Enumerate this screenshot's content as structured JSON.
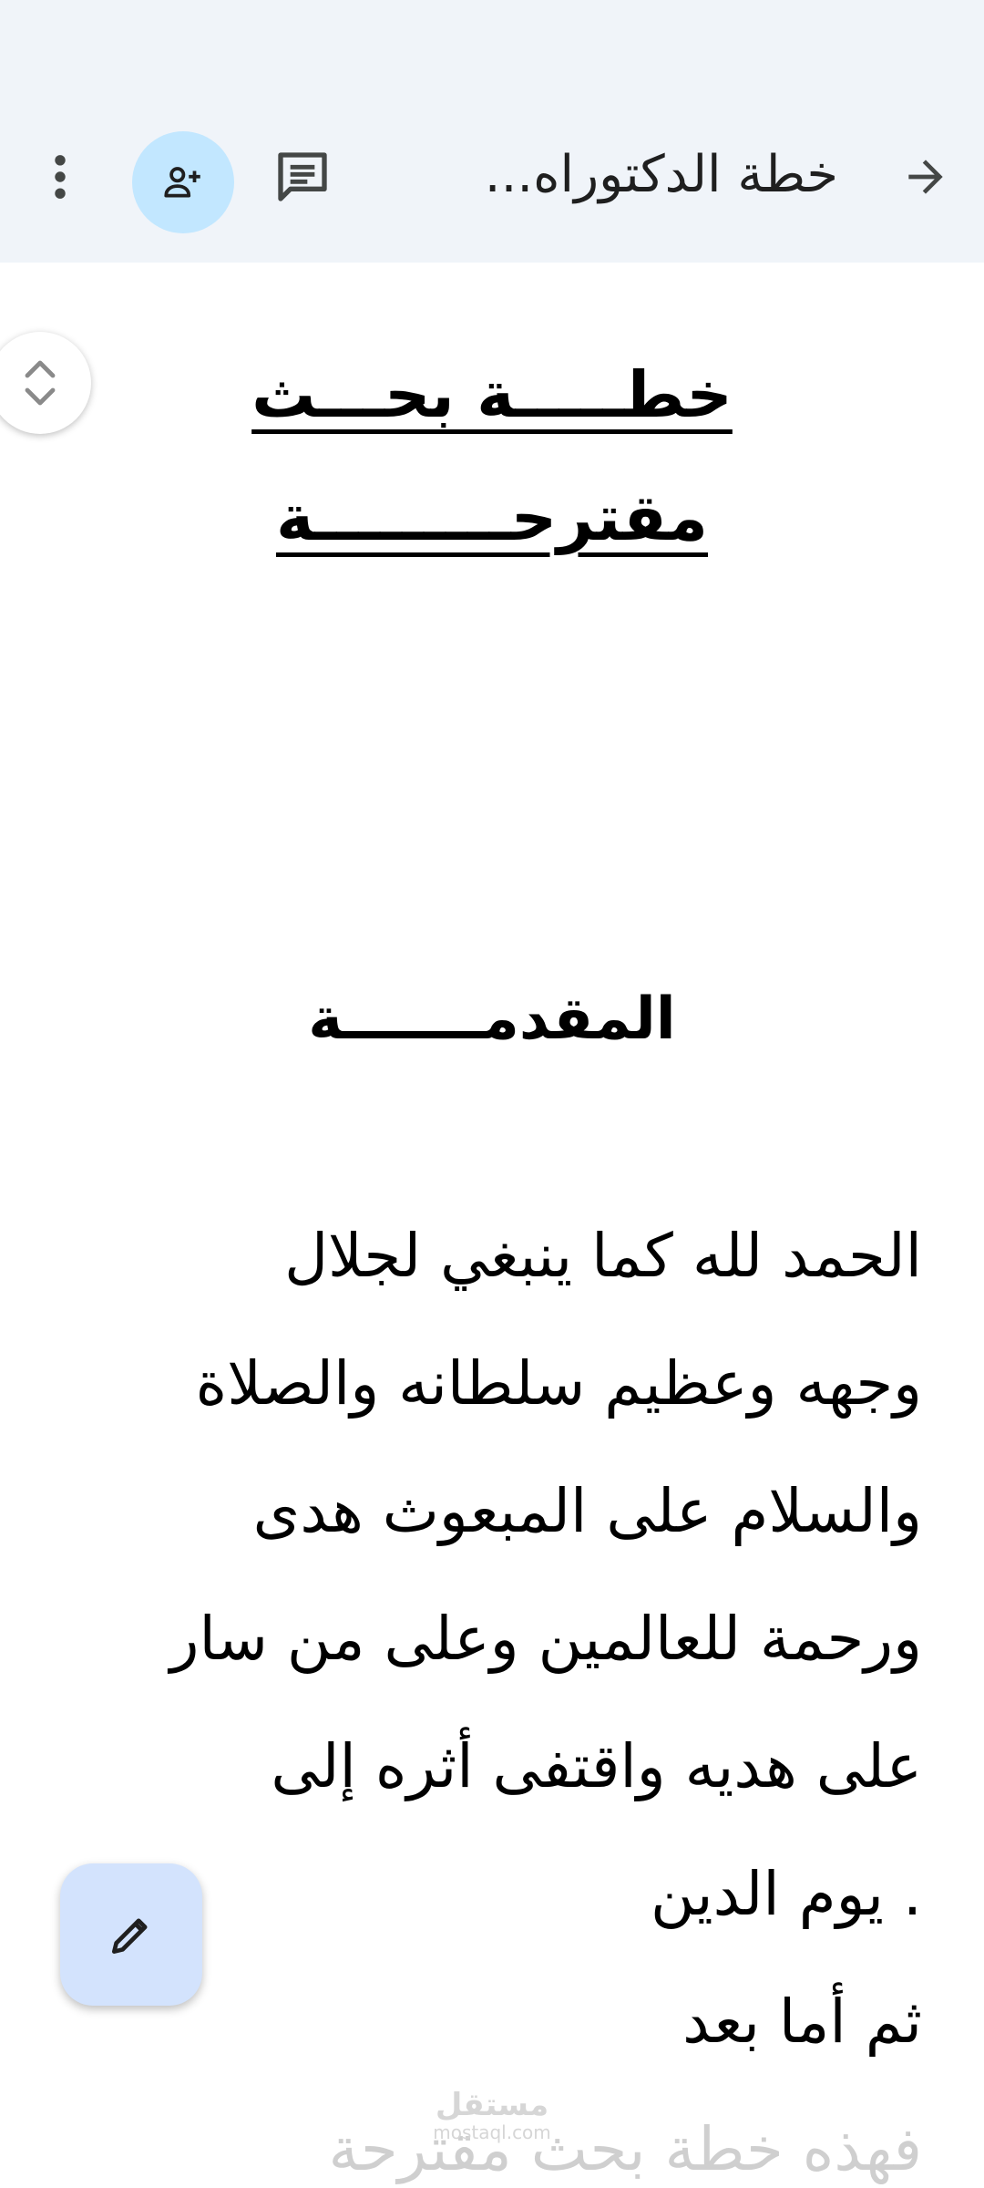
{
  "app_bar": {
    "title": "خطة الدكتوراه...",
    "back_icon": "arrow-forward-icon",
    "comment_icon": "comment-icon",
    "share_icon": "person-add-icon",
    "more_icon": "more-vertical-icon",
    "background": "#f0f4f9",
    "share_bg": "#c2e7ff"
  },
  "document": {
    "title_line1": "خطـــــة بحـــث",
    "title_line2": "مقترحـــــــــة",
    "heading": "المقدمـــــــة",
    "body_lines": [
      "الحمد لله كما ينبغي لجلال",
      "وجهه وعظيم سلطانه والصلاة",
      "والسلام على المبعوث هدى",
      "ورحمة للعالمين وعلى من سار",
      "على هديه واقتفى أثره إلى",
      ". يوم الدين",
      "ثم أما بعد",
      "فهذه خطة بحث مقترحة"
    ]
  },
  "watermark": {
    "arabic": "مستقل",
    "latin": "mostaql.com"
  },
  "fab": {
    "icon": "edit-pencil-icon",
    "color": "#d3e3fd"
  },
  "scroll_handle": {
    "icon": "chevron-up-down-icon"
  }
}
